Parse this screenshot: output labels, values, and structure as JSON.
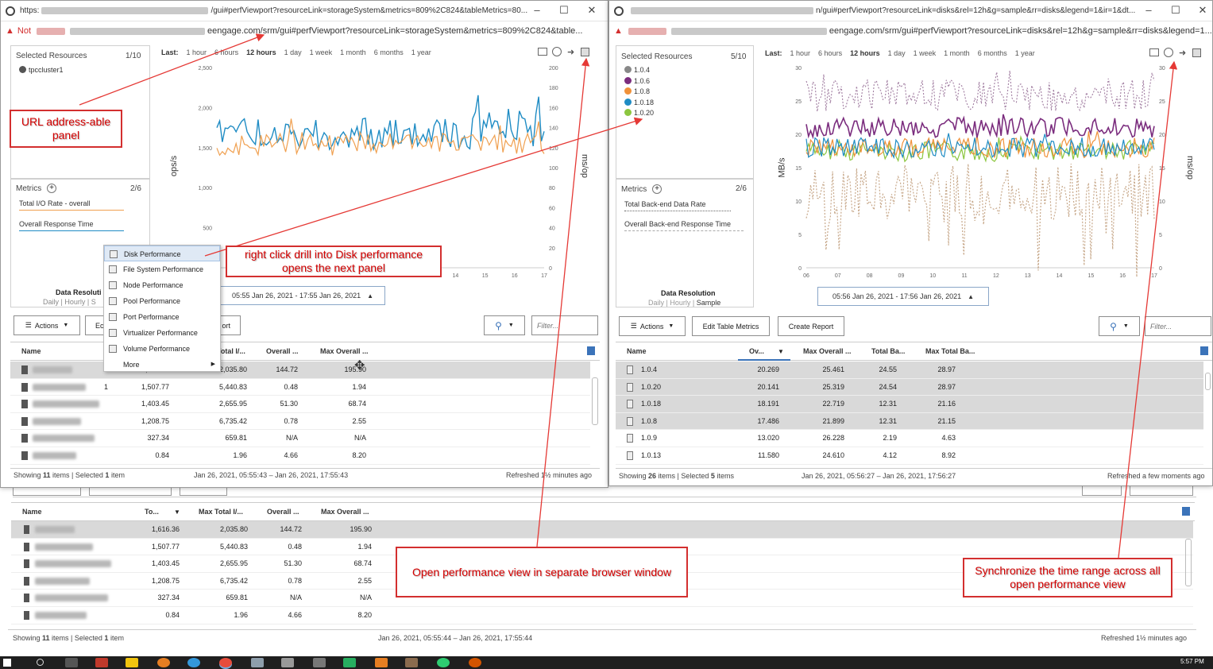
{
  "left_window": {
    "title_prefix": "https:",
    "title_suffix": "/gui#perfViewport?resourceLink=storageSystem&metrics=809%2C824&tableMetrics=80...",
    "address_warning": "Not",
    "address_url": "eengage.com/srm/gui#perfViewport?resourceLink=storageSystem&metrics=809%2C824&table...",
    "selected_resources_label": "Selected Resources",
    "selected_resources_count": "1/10",
    "resource": "tpccluster1",
    "metrics_label": "Metrics",
    "metrics_count": "2/6",
    "metric1": "Total I/O Rate - overall",
    "metric2": "Overall Response Time",
    "data_resolution": "Data Resoluti",
    "resolution_opts": "Daily | Hourly | S",
    "date_range": "05:55 Jan 26, 2021 - 17:55 Jan 26, 2021",
    "time_last": "Last:",
    "time_opts": [
      "1 hour",
      "6 hours",
      "12 hours",
      "1 day",
      "1 week",
      "1 month",
      "6 months",
      "1 year"
    ],
    "time_selected": "12 hours",
    "y_left_label": "ops/s",
    "y_right_label": "ms/op",
    "y_left_ticks": [
      "2,500",
      "2,000",
      "1,500",
      "1,000",
      "500"
    ],
    "y_right_ticks": [
      "200",
      "180",
      "160",
      "140",
      "120",
      "100",
      "80",
      "60",
      "40",
      "20",
      "0"
    ],
    "x_ticks": [
      "07",
      "08",
      "09",
      "10",
      "11",
      "12",
      "13",
      "14",
      "15",
      "16",
      "17"
    ],
    "actions": "Actions",
    "edit_frag": "Ec",
    "report_frag": "ort",
    "filter_placeholder": "Filter...",
    "headers": [
      "Name",
      "Total I/...",
      "Overall ...",
      "Max Overall ..."
    ],
    "rows": [
      {
        "c1": "1,616.36",
        "c2": "2,035.80",
        "c3": "144.72",
        "c4": "195.90"
      },
      {
        "c1": "1,507.77",
        "c2": "5,440.83",
        "c3": "0.48",
        "c4": "1.94",
        "suffix": "1"
      },
      {
        "c1": "1,403.45",
        "c2": "2,655.95",
        "c3": "51.30",
        "c4": "68.74"
      },
      {
        "c1": "1,208.75",
        "c2": "6,735.42",
        "c3": "0.78",
        "c4": "2.55"
      },
      {
        "c1": "327.34",
        "c2": "659.81",
        "c3": "N/A",
        "c4": "N/A"
      },
      {
        "c1": "0.84",
        "c2": "1.96",
        "c3": "4.66",
        "c4": "8.20"
      }
    ],
    "footer_left_a": "Showing ",
    "footer_items": "11",
    "footer_left_b": " items | Selected ",
    "footer_sel": "1",
    "footer_left_c": " item",
    "footer_mid": "Jan 26, 2021, 05:55:43 – Jan 26, 2021, 17:55:43",
    "footer_right": "Refreshed 1½ minutes ago"
  },
  "context_menu": [
    "Disk Performance",
    "File System Performance",
    "Node Performance",
    "Pool Performance",
    "Port Performance",
    "Virtualizer Performance",
    "Volume Performance",
    "More"
  ],
  "right_window": {
    "title_suffix": "n/gui#perfViewport?resourceLink=disks&rel=12h&g=sample&rr=disks&legend=1&ir=1&dt...",
    "address_url": "eengage.com/srm/gui#perfViewport?resourceLink=disks&rel=12h&g=sample&rr=disks&legend=1...",
    "selected_resources_label": "Selected Resources",
    "selected_resources_count": "5/10",
    "resources": [
      "1.0.4",
      "1.0.6",
      "1.0.8",
      "1.0.18",
      "1.0.20"
    ],
    "resource_colors": [
      "#888888",
      "#7b2d7e",
      "#f0913a",
      "#1f8cc4",
      "#8cc63f"
    ],
    "metrics_label": "Metrics",
    "metrics_count": "2/6",
    "metric1": "Total Back-end Data Rate",
    "metric2": "Overall Back-end Response Time",
    "data_resolution": "Data Resolution",
    "res_daily": "Daily",
    "res_hourly": "Hourly",
    "res_sample": "Sample",
    "date_range": "05:56 Jan 26, 2021 - 17:56 Jan 26, 2021",
    "y_left_label": "MB/s",
    "y_right_label": "ms/op",
    "y_left_ticks": [
      "30",
      "25",
      "20",
      "15",
      "10",
      "5",
      "0"
    ],
    "y_right_ticks": [
      "30",
      "25",
      "20",
      "15",
      "10",
      "5",
      "0"
    ],
    "x_ticks": [
      "06",
      "07",
      "08",
      "09",
      "10",
      "11",
      "12",
      "13",
      "14",
      "15",
      "16",
      "17"
    ],
    "actions": "Actions",
    "edit_metrics": "Edit Table Metrics",
    "create_report": "Create Report",
    "filter_placeholder": "Filter...",
    "headers": [
      "Name",
      "Ov...",
      "Max Overall ...",
      "Total Ba...",
      "Max Total Ba..."
    ],
    "rows": [
      {
        "name": "1.0.4",
        "c1": "20.269",
        "c2": "25.461",
        "c3": "24.55",
        "c4": "28.97",
        "sel": true
      },
      {
        "name": "1.0.20",
        "c1": "20.141",
        "c2": "25.319",
        "c3": "24.54",
        "c4": "28.97",
        "sel": true
      },
      {
        "name": "1.0.18",
        "c1": "18.191",
        "c2": "22.719",
        "c3": "12.31",
        "c4": "21.16",
        "sel": true
      },
      {
        "name": "1.0.8",
        "c1": "17.486",
        "c2": "21.899",
        "c3": "12.31",
        "c4": "21.15",
        "sel": true
      },
      {
        "name": "1.0.9",
        "c1": "13.020",
        "c2": "26.228",
        "c3": "2.19",
        "c4": "4.63",
        "sel": false
      },
      {
        "name": "1.0.13",
        "c1": "11.580",
        "c2": "24.610",
        "c3": "4.12",
        "c4": "8.92",
        "sel": false
      }
    ],
    "footer_a": "Showing ",
    "footer_items": "26",
    "footer_b": " items | Selected ",
    "footer_sel": "5",
    "footer_c": " items",
    "footer_mid": "Jan 26, 2021, 05:56:27 – Jan 26, 2021, 17:56:27",
    "footer_right": "Refreshed a few moments ago"
  },
  "bottom_table": {
    "headers": [
      "Name",
      "To...",
      "Max Total I/...",
      "Overall ...",
      "Max Overall ..."
    ],
    "rows": [
      {
        "c1": "1,616.36",
        "c2": "2,035.80",
        "c3": "144.72",
        "c4": "195.90"
      },
      {
        "c1": "1,507.77",
        "c2": "5,440.83",
        "c3": "0.48",
        "c4": "1.94"
      },
      {
        "c1": "1,403.45",
        "c2": "2,655.95",
        "c3": "51.30",
        "c4": "68.74"
      },
      {
        "c1": "1,208.75",
        "c2": "6,735.42",
        "c3": "0.78",
        "c4": "2.55"
      },
      {
        "c1": "327.34",
        "c2": "659.81",
        "c3": "N/A",
        "c4": "N/A"
      },
      {
        "c1": "0.84",
        "c2": "1.96",
        "c3": "4.66",
        "c4": "8.20"
      }
    ],
    "footer_a": "Showing ",
    "footer_items": "11",
    "footer_b": " items | Selected ",
    "footer_sel": "1",
    "footer_c": " item",
    "footer_mid": "Jan 26, 2021, 05:55:44 – Jan 26, 2021, 17:55:44",
    "footer_right": "Refreshed 1½ minutes ago"
  },
  "callouts": {
    "url": "URL address-able panel",
    "drill": "right click drill into Disk performance opens the next panel",
    "open_window": "Open performance view in separate browser window",
    "sync": "Synchronize the time range across all open performance view"
  },
  "taskbar": {
    "clock": "5:57 PM"
  },
  "colors": {
    "accent_red": "#d32f2f",
    "line_blue": "#1f8cc4",
    "line_orange": "#f0a050",
    "purple": "#7b2d7e",
    "tan": "#c7a88a"
  }
}
